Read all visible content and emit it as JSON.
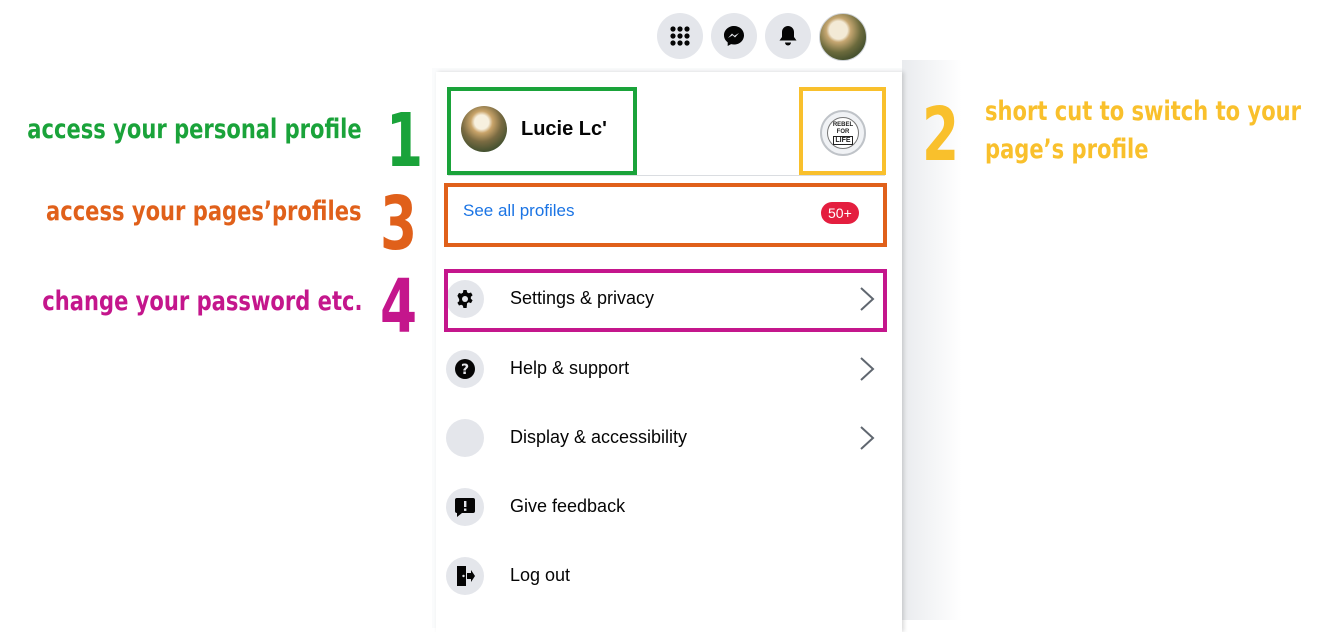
{
  "topbar": {
    "menu_icon": "grid-menu-icon",
    "messenger_icon": "messenger-icon",
    "notifications_icon": "bell-icon"
  },
  "account": {
    "profile_name": "Lucie Lc'",
    "page_logo_lines": [
      "REBEL",
      "FOR",
      "LIFE"
    ],
    "see_all_label": "See all profiles",
    "see_all_badge": "50+"
  },
  "menu": {
    "items": [
      {
        "label": "Settings & privacy",
        "icon": "gear-icon",
        "chevron": true
      },
      {
        "label": "Help & support",
        "icon": "question-icon",
        "chevron": true
      },
      {
        "label": "Display & accessibility",
        "icon": "moon-icon",
        "chevron": true
      },
      {
        "label": "Give feedback",
        "icon": "feedback-icon",
        "chevron": false
      },
      {
        "label": "Log out",
        "icon": "logout-icon",
        "chevron": false
      }
    ]
  },
  "annotations": {
    "one": {
      "number": "1",
      "text": "access your personal profile",
      "color": "#1aa33a"
    },
    "two": {
      "number": "2",
      "text_line1": "short cut to switch to your",
      "text_line2": "page’s profile",
      "color": "#f9c02c"
    },
    "three": {
      "number": "3",
      "text": "access your pages’profiles",
      "color": "#e0601a"
    },
    "four": {
      "number": "4",
      "text": "change your password etc.",
      "color": "#c4168c"
    }
  },
  "colors": {
    "link_blue": "#1b74e4",
    "badge_red": "#e41e3f",
    "icon_bg": "#e4e6eb"
  }
}
